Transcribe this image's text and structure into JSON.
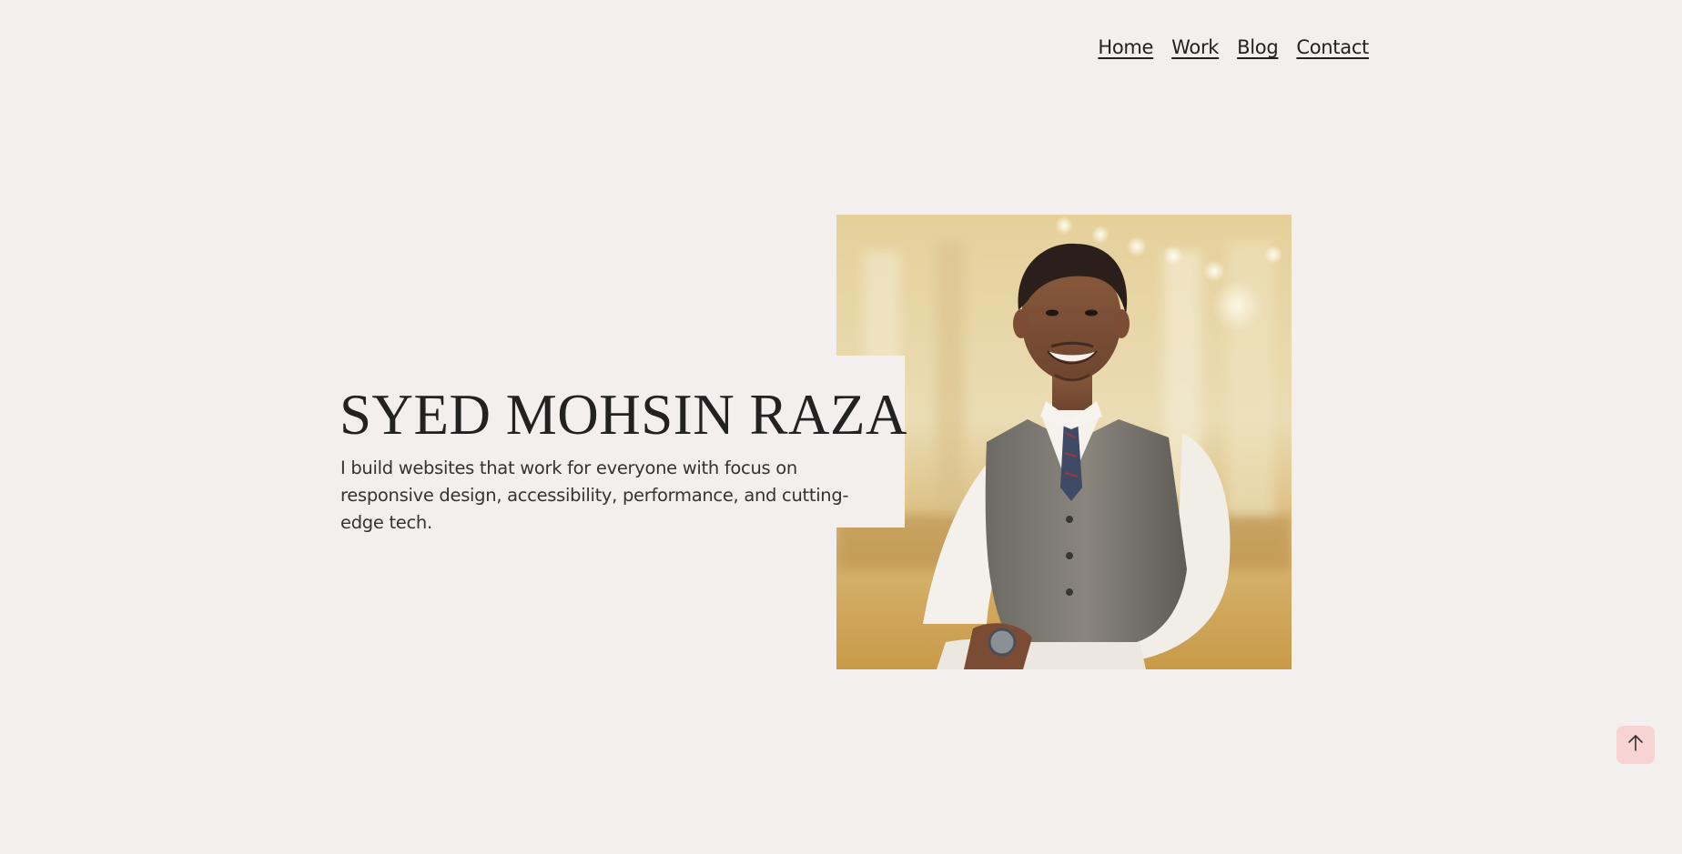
{
  "nav": {
    "items": [
      {
        "label": "Home"
      },
      {
        "label": "Work"
      },
      {
        "label": "Blog"
      },
      {
        "label": "Contact"
      }
    ]
  },
  "hero": {
    "title": "SYED MOHSIN RAZA",
    "description": "I build websites that work for everyone with focus on responsive design, accessibility, performance, and cutting-edge tech."
  },
  "icons": {
    "back_to_top": "arrow-up-icon"
  },
  "colors": {
    "background": "#f2efee",
    "text": "#222222",
    "back_to_top_bg": "#f8d3d3"
  }
}
